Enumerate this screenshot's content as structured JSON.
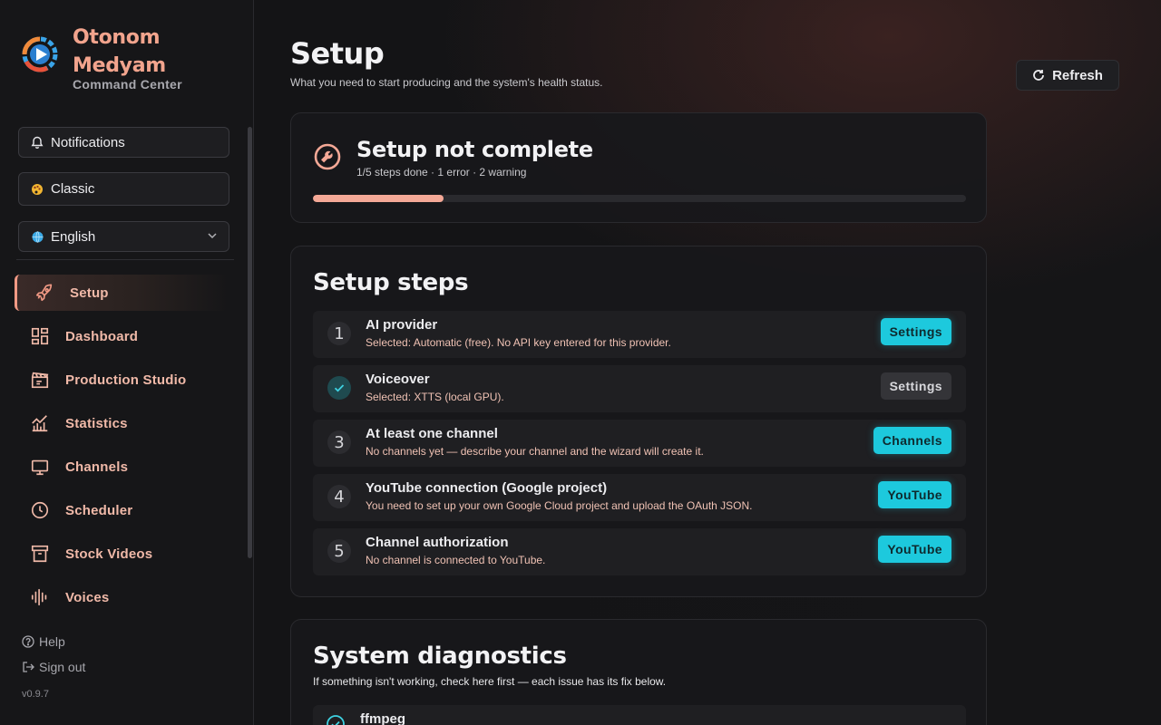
{
  "brand": {
    "name_line1": "Otonom",
    "name_line2": "Medyam",
    "subtitle": "Command Center"
  },
  "sidebar": {
    "notifications_label": "Notifications",
    "theme_label": "Classic",
    "language_label": "English",
    "nav": [
      {
        "label": "Setup",
        "icon": "rocket-icon",
        "active": true
      },
      {
        "label": "Dashboard",
        "icon": "dashboard-icon"
      },
      {
        "label": "Production Studio",
        "icon": "clapperboard-icon"
      },
      {
        "label": "Statistics",
        "icon": "chart-icon"
      },
      {
        "label": "Channels",
        "icon": "tv-icon"
      },
      {
        "label": "Scheduler",
        "icon": "clock-icon"
      },
      {
        "label": "Stock Videos",
        "icon": "archive-icon"
      },
      {
        "label": "Voices",
        "icon": "waveform-icon"
      }
    ],
    "help_label": "Help",
    "signout_label": "Sign out",
    "version": "v0.9.7"
  },
  "header": {
    "title": "Setup",
    "subtitle": "What you need to start producing and the system's health status.",
    "refresh_label": "Refresh"
  },
  "status": {
    "title": "Setup not complete",
    "meta": "1/5 steps done · 1 error · 2 warning",
    "progress_fraction": 0.2,
    "accent": "#f4a896"
  },
  "steps": {
    "title": "Setup steps",
    "items": [
      {
        "num": "1",
        "done": false,
        "title": "AI provider",
        "desc": "Selected: Automatic (free). No API key entered for this provider.",
        "button": "Settings"
      },
      {
        "num": "",
        "done": true,
        "title": "Voiceover",
        "desc": "Selected: XTTS (local GPU).",
        "button": "Settings"
      },
      {
        "num": "3",
        "done": false,
        "title": "At least one channel",
        "desc": "No channels yet — describe your channel and the wizard will create it.",
        "button": "Channels"
      },
      {
        "num": "4",
        "done": false,
        "title": "YouTube connection (Google project)",
        "desc": "You need to set up your own Google Cloud project and upload the OAuth JSON.",
        "button": "YouTube"
      },
      {
        "num": "5",
        "done": false,
        "title": "Channel authorization",
        "desc": "No channel is connected to YouTube.",
        "button": "YouTube"
      }
    ]
  },
  "diagnostics": {
    "title": "System diagnostics",
    "subtitle": "If something isn't working, check here first — each issue has its fix below.",
    "first_item": "ffmpeg"
  },
  "colors": {
    "brand": "#f2a48d",
    "cta": "#1dc9dd",
    "nav_text": "#f0b9a8"
  }
}
